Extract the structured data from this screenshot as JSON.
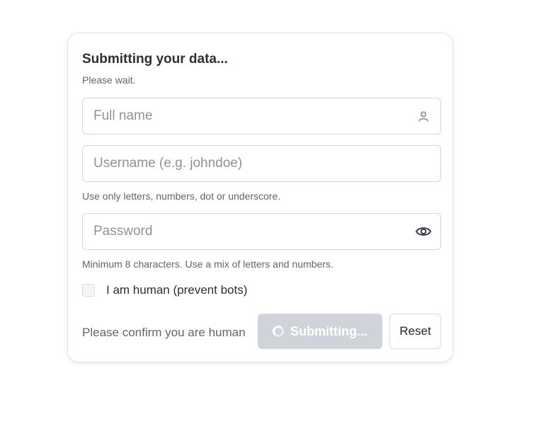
{
  "form": {
    "title": "Submitting your data...",
    "subtitle": "Please wait.",
    "full_name": {
      "placeholder": "Full name",
      "value": "",
      "icon": "user-icon"
    },
    "username": {
      "placeholder": "Username (e.g. johndoe)",
      "value": "",
      "hint": "Use only letters, numbers, dot or underscore."
    },
    "password": {
      "placeholder": "Password",
      "value": "",
      "icon": "eye-icon",
      "hint": "Minimum 8 characters. Use a mix of letters and numbers."
    },
    "human_check": {
      "label": "I am human (prevent bots)",
      "checked": false
    },
    "confirm_text": "Please confirm you are human",
    "submit_label": "Submitting...",
    "reset_label": "Reset"
  },
  "colors": {
    "submit_disabled_bg": "#d0d3da",
    "text_primary": "#2b2f36",
    "text_secondary": "#5f6570",
    "border": "#d4d6db"
  }
}
